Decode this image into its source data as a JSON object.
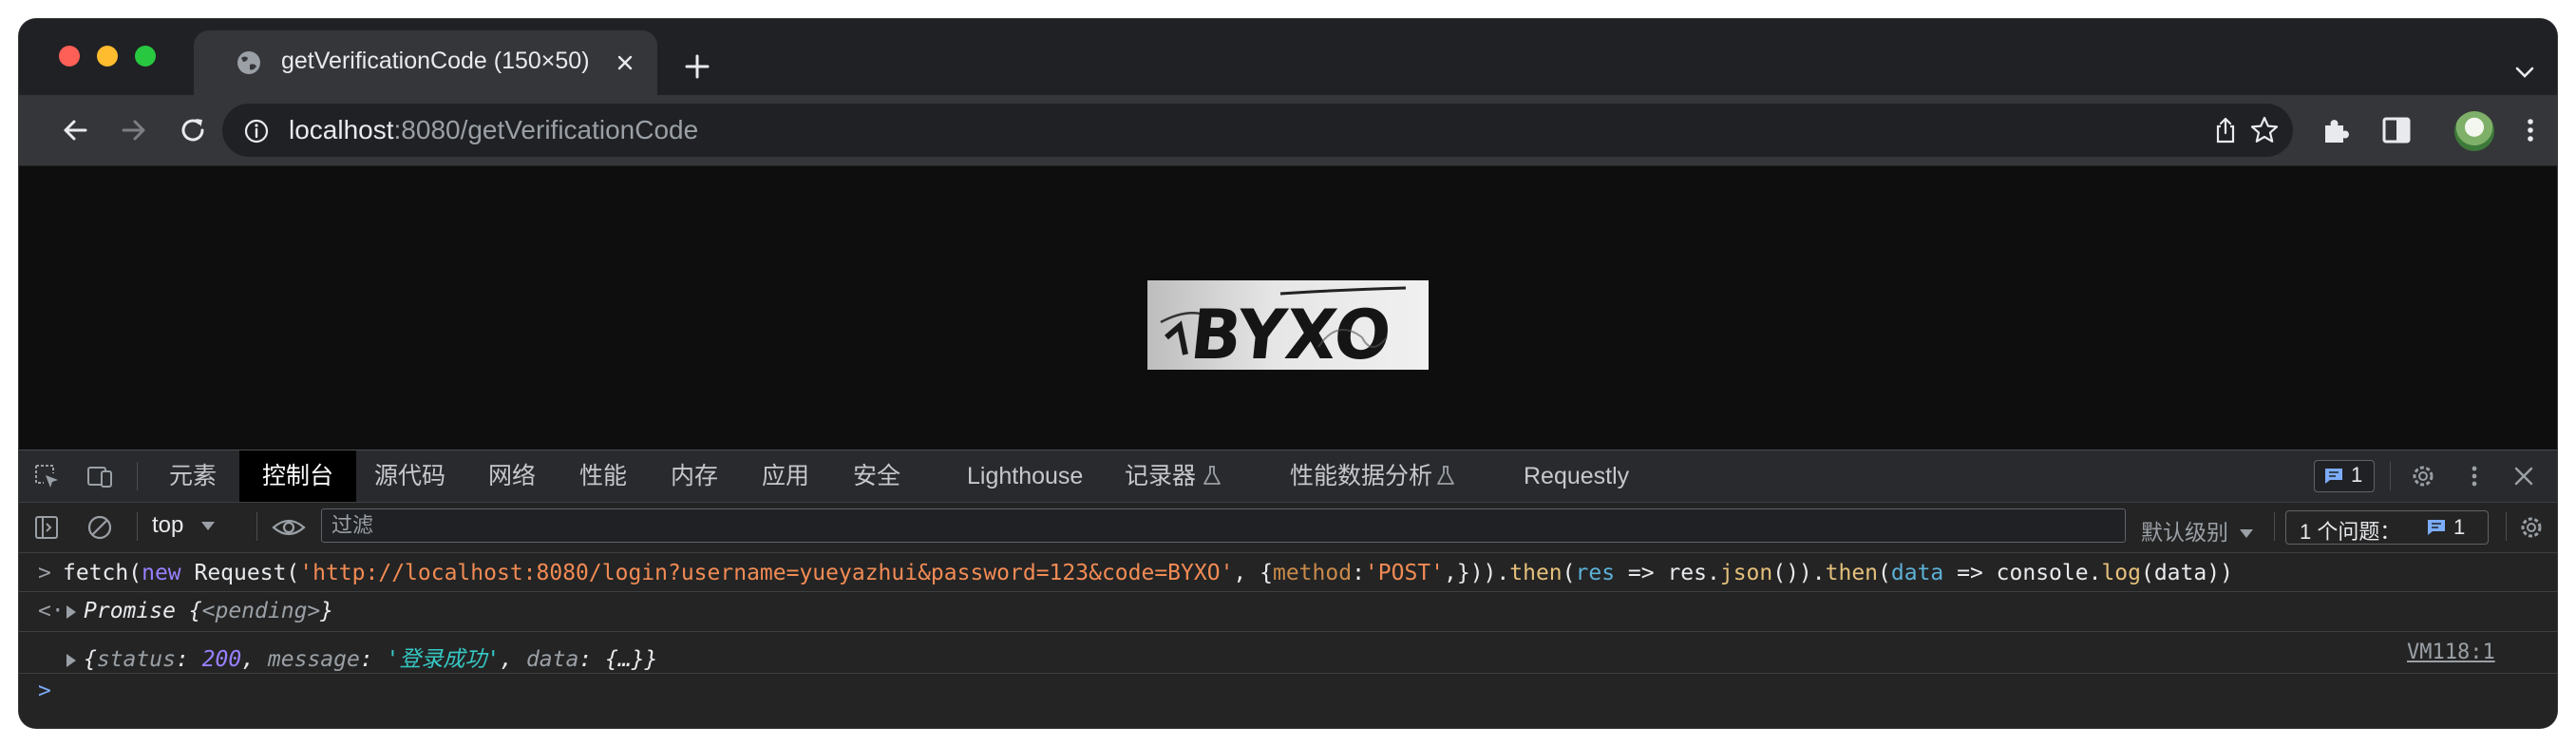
{
  "browser": {
    "tab": {
      "title": "getVerificationCode (150×50)"
    },
    "address_bar": {
      "host": "localhost",
      "path": ":8080/getVerificationCode"
    }
  },
  "page": {
    "captcha": {
      "text": "BYXO",
      "icon": "captcha-image"
    }
  },
  "devtools": {
    "tabs": [
      {
        "label": "元素"
      },
      {
        "label": "控制台",
        "active": true
      },
      {
        "label": "源代码"
      },
      {
        "label": "网络"
      },
      {
        "label": "性能"
      },
      {
        "label": "内存"
      },
      {
        "label": "应用"
      },
      {
        "label": "安全"
      },
      {
        "label": "Lighthouse"
      },
      {
        "label": "记录器"
      },
      {
        "label": "性能数据分析"
      },
      {
        "label": "Requestly"
      }
    ],
    "issues_badge_count": "1",
    "filter_bar": {
      "context": "top",
      "filter_placeholder": "过滤",
      "levels": "默认级别",
      "issues_label": "1 个问题：",
      "issues_count": "1"
    },
    "console": {
      "input": {
        "prefix": "fetch(",
        "kw_new": "new",
        "request": " Request(",
        "url": "'http://localhost:8080/login?username=yueyazhui&password=123&code=BYXO'",
        "comma_brace": ", {",
        "method_key": "method",
        "colon": ":",
        "method_val": "'POST'",
        "close1": ",})).",
        "then1": "then",
        "open1": "(",
        "res": "res",
        "arrow1": " => res.",
        "json": "json",
        "close2": "()).",
        "then2": "then",
        "open2": "(",
        "data_param": "data",
        "arrow2": " => console.",
        "log": "log",
        "close3": "(data))"
      },
      "promise": {
        "label": "Promise",
        "open": " {",
        "state": "<pending>",
        "close": "}"
      },
      "result": {
        "open": "{",
        "k1": "status",
        "v1": "200",
        "k2": "message",
        "v2": "'登录成功'",
        "k3": "data",
        "v3": "{…}",
        "close": "}",
        "source": "VM118:1"
      }
    }
  }
}
